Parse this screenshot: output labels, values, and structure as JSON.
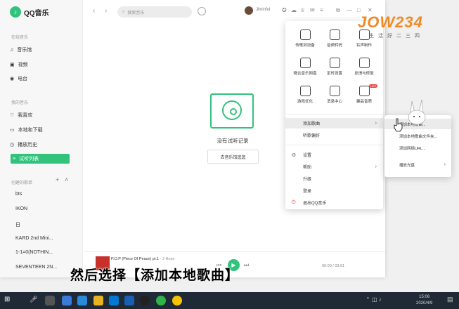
{
  "app": {
    "name": "QQ音乐"
  },
  "sidebar": {
    "section_online": "在线音乐",
    "online_items": [
      {
        "label": "音乐馆",
        "icon": "music-note-icon"
      },
      {
        "label": "视频",
        "icon": "video-icon"
      },
      {
        "label": "电台",
        "icon": "radio-icon"
      }
    ],
    "section_mine": "我的音乐",
    "mine_items": [
      {
        "label": "我喜欢",
        "icon": "heart-icon"
      },
      {
        "label": "本地和下载",
        "icon": "monitor-icon"
      },
      {
        "label": "播放历史",
        "icon": "history-icon"
      },
      {
        "label": "试听列表",
        "icon": "list-icon"
      }
    ],
    "section_created": "创建的歌单",
    "playlists": [
      "bts",
      "IKON",
      "日",
      "KARD 2nd Mini...",
      "1-1=0(NOTHIN...",
      "SEVENTEEN 2N..."
    ]
  },
  "topbar": {
    "search_placeholder": "搜索音乐",
    "username": "Jiminful"
  },
  "main": {
    "empty_text": "没有试听记录",
    "go_button": "去音乐馆逛逛"
  },
  "player": {
    "song_title": "P.O.P (Piece Of Peace) pt.1",
    "song_artist": " - J-Hope",
    "time": "00:00 / 03:01"
  },
  "menu": {
    "tiles": [
      {
        "label": "传歌到设备",
        "icon": "phone-icon"
      },
      {
        "label": "音频转码",
        "icon": "waveform-icon"
      },
      {
        "label": "铃声制作",
        "icon": "ringtone-icon"
      },
      {
        "label": "微云音乐网盘",
        "icon": "cloud-icon"
      },
      {
        "label": "定时设置",
        "icon": "clock-icon"
      },
      {
        "label": "反馈与修复",
        "icon": "feedback-icon"
      },
      {
        "label": "游戏优化",
        "icon": "gamepad-icon"
      },
      {
        "label": "消息中心",
        "icon": "mail-icon"
      },
      {
        "label": "臻品音质",
        "icon": "hq-icon",
        "badge": "HOT"
      }
    ],
    "items": [
      {
        "label": "添加歌曲",
        "arrow": "›"
      },
      {
        "label": "听歌偏好"
      },
      {
        "label": "设置",
        "icon": "⚙"
      },
      {
        "label": "帮助",
        "arrow": "›"
      },
      {
        "label": "升级"
      },
      {
        "label": "登录"
      },
      {
        "label": "退出QQ音乐",
        "icon": "⏻"
      }
    ]
  },
  "submenu": {
    "items": [
      {
        "label": "添加本地歌曲..."
      },
      {
        "label": "添加本地歌曲文件夹..."
      },
      {
        "label": "添加网络URL..."
      },
      {
        "label": "播放光盘",
        "arrow": "›"
      }
    ]
  },
  "overlay": {
    "brand": "JOW234",
    "brand_sub": "生活好二三四",
    "caption": "然后选择【添加本地歌曲】"
  },
  "taskbar": {
    "time": "15:06",
    "date": "2020/4/9"
  },
  "colors": {
    "accent": "#31c27c",
    "taskbar": "#1f2a36"
  }
}
